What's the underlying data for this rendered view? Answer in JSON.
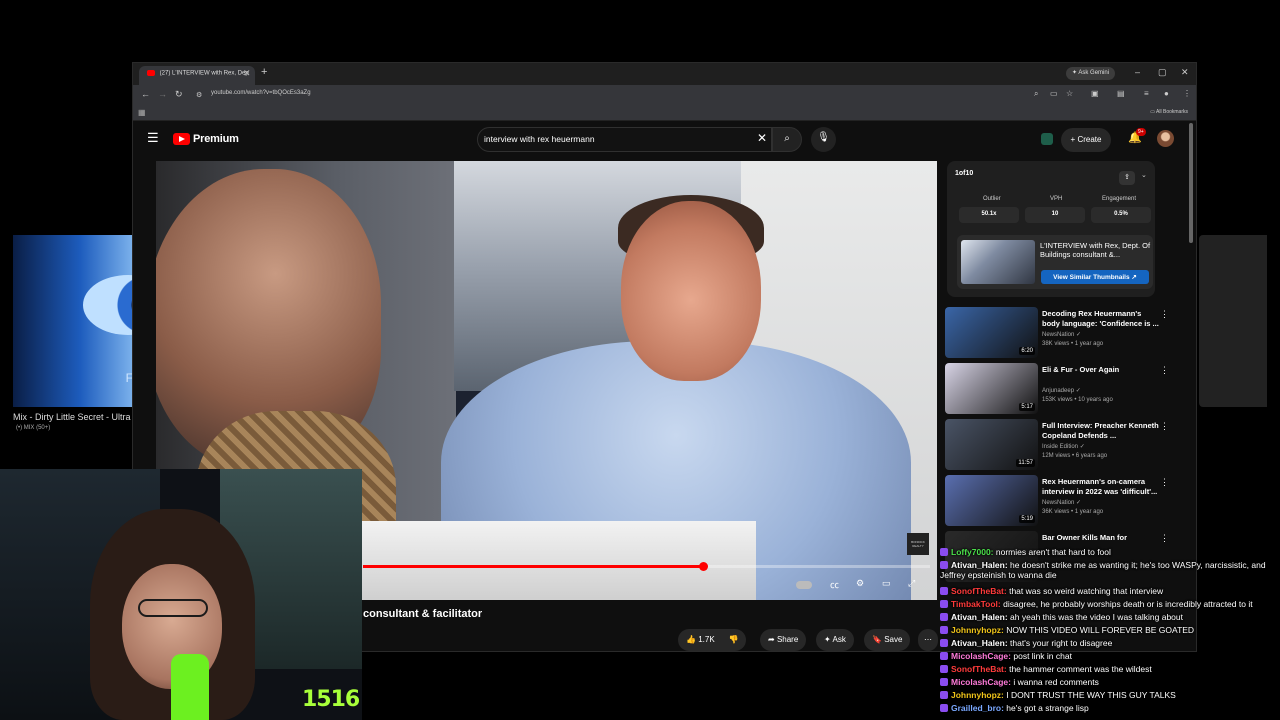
{
  "left_thumb": {
    "title": "Mix - Dirty Little Secret - Ultra",
    "sub": "(•) MIX (50+)",
    "overlay_char": "F"
  },
  "browser": {
    "tab_title": "(27) L'INTERVIEW with Rex, Dep",
    "url": "youtube.com/watch?v=tbQOcEs3aZg",
    "ask_gemini": "Ask Gemini",
    "all_bookmarks": "All Bookmarks"
  },
  "yt": {
    "logo_text": "Premium",
    "search_query": "interview with rex heuermann",
    "create_label": "Create",
    "notif_count": "9+"
  },
  "player": {
    "progress": 0.6,
    "watermark": "BONDICK REALTY"
  },
  "video": {
    "title_visible": "consultant & facilitator",
    "likes": "1.7K",
    "share": "Share",
    "ask": "Ask",
    "save": "Save"
  },
  "ext": {
    "logo": "1of10",
    "stats": [
      {
        "label": "Outlier",
        "value": "50.1x"
      },
      {
        "label": "VPH",
        "value": "10"
      },
      {
        "label": "Engagement",
        "value": "0.5%"
      }
    ],
    "card_title": "L'INTERVIEW with Rex, Dept. Of Buildings consultant &...",
    "card_button": "View Similar Thumbnails"
  },
  "recs": [
    {
      "title": "Decoding Rex Heuermann's body language: 'Confidence is ...",
      "channel": "NewsNation",
      "meta": "38K views • 1 year ago",
      "duration": "6:20",
      "color": "#3a66a8"
    },
    {
      "title": "Eli & Fur - Over Again",
      "channel": "Anjunadeep",
      "meta": "153K views • 10 years ago",
      "duration": "5:17",
      "color": "#d8d4e6"
    },
    {
      "title": "Full Interview: Preacher Kenneth Copeland Defends ...",
      "channel": "Inside Edition",
      "meta": "12M views • 6 years ago",
      "duration": "11:57",
      "color": "#4a5466"
    },
    {
      "title": "Rex Heuermann's on-camera interview in 2022 was 'difficult'...",
      "channel": "NewsNation",
      "meta": "36K views • 1 year ago",
      "duration": "5:19",
      "color": "#5a6fb0"
    },
    {
      "title": "Bar Owner Kills Man for",
      "channel": "",
      "meta": "",
      "duration": "",
      "color": "#2a2a2a"
    }
  ],
  "webcam": {
    "counter": "1516"
  },
  "chat": [
    {
      "user": "Loffy7000",
      "color": "#4be04b",
      "msg": "normies aren't that hard to fool"
    },
    {
      "user": "Ativan_Halen",
      "color": "#ffffff",
      "msg": "he doesn't strike me as wanting it; he's too WASPy, narcissistic, and Jeffrey epsteinish to wanna die"
    },
    {
      "user": "SonofTheBat",
      "color": "#ff3b3b",
      "msg": "that was so weird watching that interview"
    },
    {
      "user": "TimbakTool",
      "color": "#ff3b3b",
      "msg": "disagree, he probably worships death or is incredibly attracted to it"
    },
    {
      "user": "Ativan_Halen",
      "color": "#ffffff",
      "msg": "ah yeah this was the video I was talking about"
    },
    {
      "user": "Johnnyhopz",
      "color": "#f0c419",
      "msg": "NOW THIS VIDEO WILL FOREVER BE GOATED"
    },
    {
      "user": "Ativan_Halen",
      "color": "#ffffff",
      "msg": "that's your right to disagree"
    },
    {
      "user": "MicolashCage",
      "color": "#ff7ad9",
      "msg": "post link in chat"
    },
    {
      "user": "SonofTheBat",
      "color": "#ff3b3b",
      "msg": "the hammer comment was the wildest"
    },
    {
      "user": "MicolashCage",
      "color": "#ff7ad9",
      "msg": "i wanna red comments"
    },
    {
      "user": "Johnnyhopz",
      "color": "#f0c419",
      "msg": "I DONT TRUST THE WAY THIS GUY TALKS"
    },
    {
      "user": "Grailled_bro",
      "color": "#7aa8ff",
      "msg": "he's got a strange lisp"
    }
  ]
}
